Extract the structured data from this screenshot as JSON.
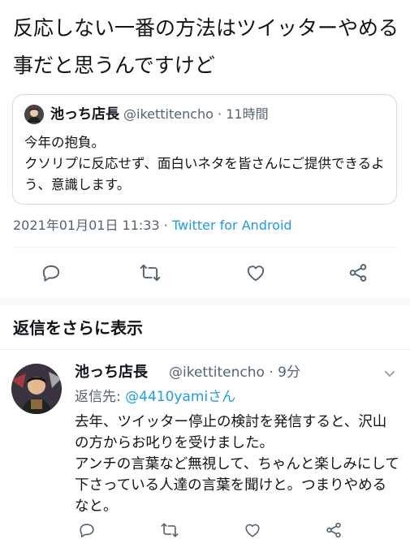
{
  "tweet": {
    "text": "反応しない一番の方法はツイッターやめる事だと思うんですけど"
  },
  "quoted_tweet": {
    "name": "池っち店長",
    "handle": "@ikettitencho",
    "time": "11時間",
    "body": "今年の抱負。\nクソリプに反応せず、面白いネタを皆さんにご提供できるよう、意識します。"
  },
  "meta": {
    "timestamp": "2021年01月01日 11:33",
    "separator": " · ",
    "source": "Twitter for Android"
  },
  "actions": {
    "icons": [
      "reply-icon",
      "retweet-icon",
      "like-icon",
      "share-icon"
    ]
  },
  "more_replies": {
    "header": "返信をさらに表示"
  },
  "reply": {
    "name": "池っち店長",
    "handle": "@ikettitencho",
    "time": "9分",
    "reply_prefix": "返信先: ",
    "mention": "@4410yamiさん",
    "body": "去年、ツイッター停止の検討を発信すると、沢山の方からお叱りを受けました。\nアンチの言葉など無視して、ちゃんと楽しみにして下さっている人達の言葉を聞けと。つまりやめるなと。"
  },
  "colors": {
    "text": "#0f1419",
    "secondary": "#536471",
    "link": "#1d9bf0",
    "border": "#cfd9de"
  }
}
